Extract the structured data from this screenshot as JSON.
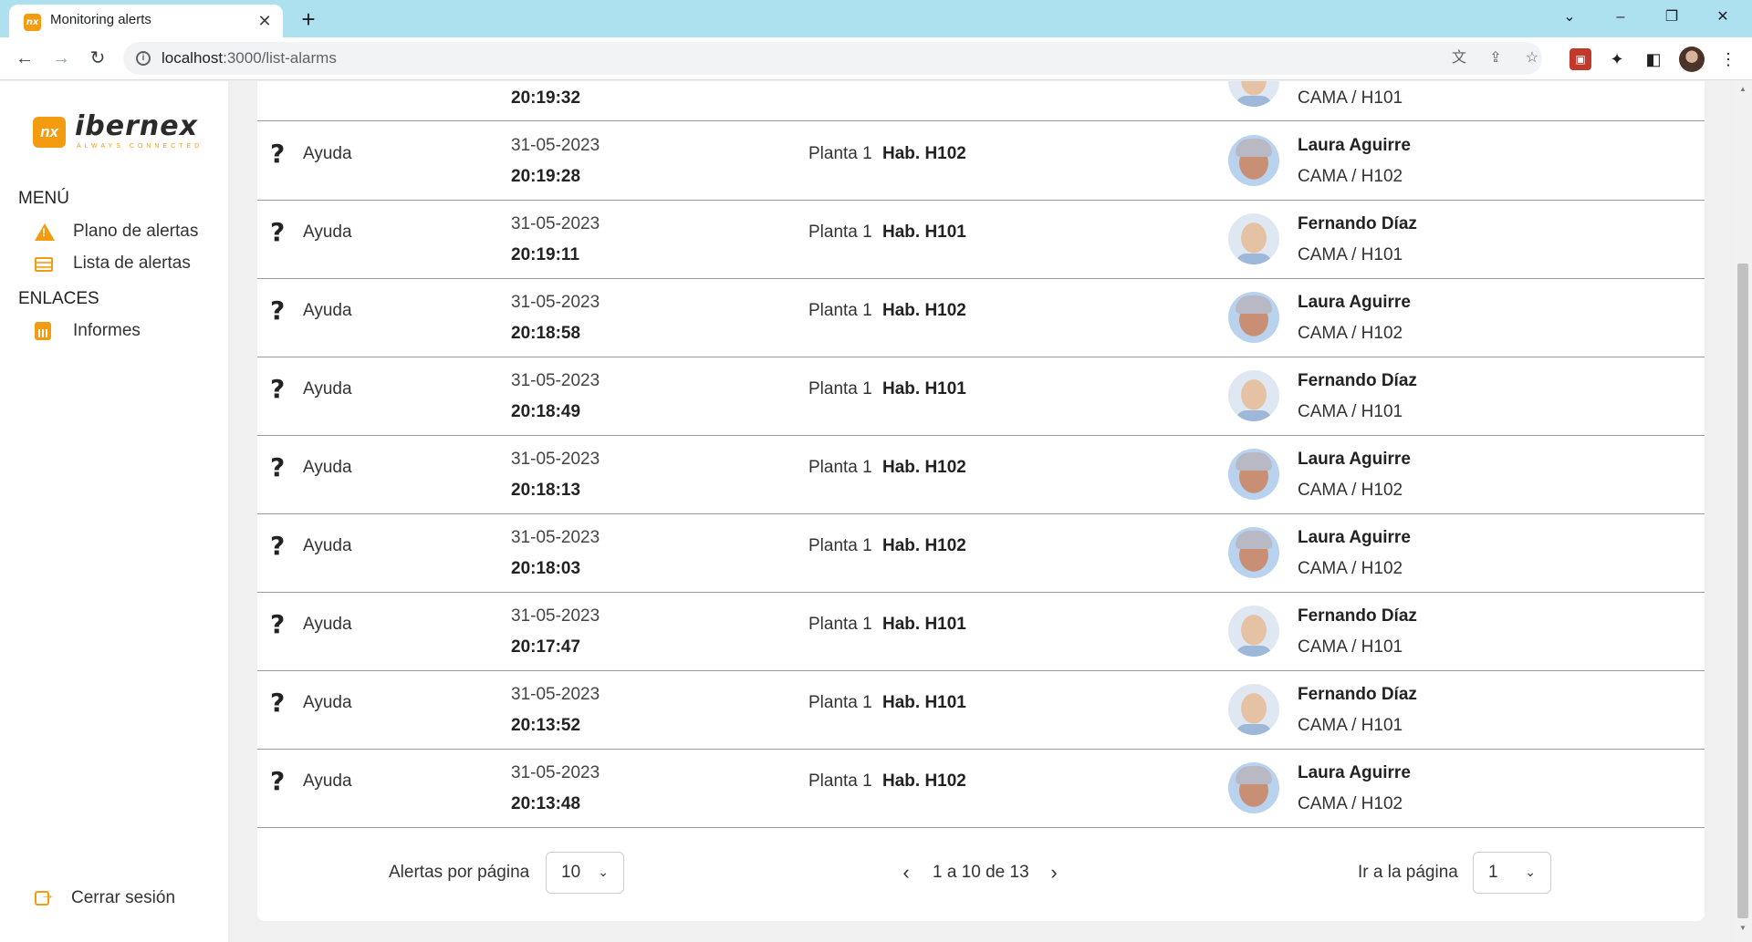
{
  "browser": {
    "tab_title": "Monitoring alerts",
    "url_host": "localhost",
    "url_rest": ":3000/list-alarms"
  },
  "sidebar": {
    "logo_text": "ibernex",
    "logo_tagline": "ALWAYS CONNECTED",
    "logo_mark": "nx",
    "menu_heading": "MENÚ",
    "menu_items": [
      {
        "label": "Plano de alertas",
        "icon": "warning-icon"
      },
      {
        "label": "Lista de alertas",
        "icon": "list-icon"
      }
    ],
    "links_heading": "ENLACES",
    "link_items": [
      {
        "label": "Informes",
        "icon": "report-icon"
      }
    ],
    "logout_label": "Cerrar sesión"
  },
  "alerts": {
    "partial_row": {
      "time": "20:19:32",
      "bed": "CAMA / H101"
    },
    "rows": [
      {
        "type": "Ayuda",
        "date": "31-05-2023",
        "time": "20:19:28",
        "floor": "Planta 1",
        "room": "Hab. H102",
        "name": "Laura Aguirre",
        "bed": "CAMA / H102",
        "avatar": "female"
      },
      {
        "type": "Ayuda",
        "date": "31-05-2023",
        "time": "20:19:11",
        "floor": "Planta 1",
        "room": "Hab. H101",
        "name": "Fernando Díaz",
        "bed": "CAMA / H101",
        "avatar": "male"
      },
      {
        "type": "Ayuda",
        "date": "31-05-2023",
        "time": "20:18:58",
        "floor": "Planta 1",
        "room": "Hab. H102",
        "name": "Laura Aguirre",
        "bed": "CAMA / H102",
        "avatar": "female"
      },
      {
        "type": "Ayuda",
        "date": "31-05-2023",
        "time": "20:18:49",
        "floor": "Planta 1",
        "room": "Hab. H101",
        "name": "Fernando Díaz",
        "bed": "CAMA / H101",
        "avatar": "male"
      },
      {
        "type": "Ayuda",
        "date": "31-05-2023",
        "time": "20:18:13",
        "floor": "Planta 1",
        "room": "Hab. H102",
        "name": "Laura Aguirre",
        "bed": "CAMA / H102",
        "avatar": "female"
      },
      {
        "type": "Ayuda",
        "date": "31-05-2023",
        "time": "20:18:03",
        "floor": "Planta 1",
        "room": "Hab. H102",
        "name": "Laura Aguirre",
        "bed": "CAMA / H102",
        "avatar": "female"
      },
      {
        "type": "Ayuda",
        "date": "31-05-2023",
        "time": "20:17:47",
        "floor": "Planta 1",
        "room": "Hab. H101",
        "name": "Fernando Díaz",
        "bed": "CAMA / H101",
        "avatar": "male"
      },
      {
        "type": "Ayuda",
        "date": "31-05-2023",
        "time": "20:13:52",
        "floor": "Planta 1",
        "room": "Hab. H101",
        "name": "Fernando Díaz",
        "bed": "CAMA / H101",
        "avatar": "male"
      },
      {
        "type": "Ayuda",
        "date": "31-05-2023",
        "time": "20:13:48",
        "floor": "Planta 1",
        "room": "Hab. H102",
        "name": "Laura Aguirre",
        "bed": "CAMA / H102",
        "avatar": "female"
      }
    ],
    "type_icon": "?"
  },
  "pagination": {
    "per_page_label": "Alertas por página",
    "per_page_value": "10",
    "range_text": "1 a 10 de 13",
    "goto_label": "Ir a la página",
    "goto_value": "1"
  },
  "colors": {
    "accent": "#f39c12",
    "tabbar": "#ade1ef"
  }
}
